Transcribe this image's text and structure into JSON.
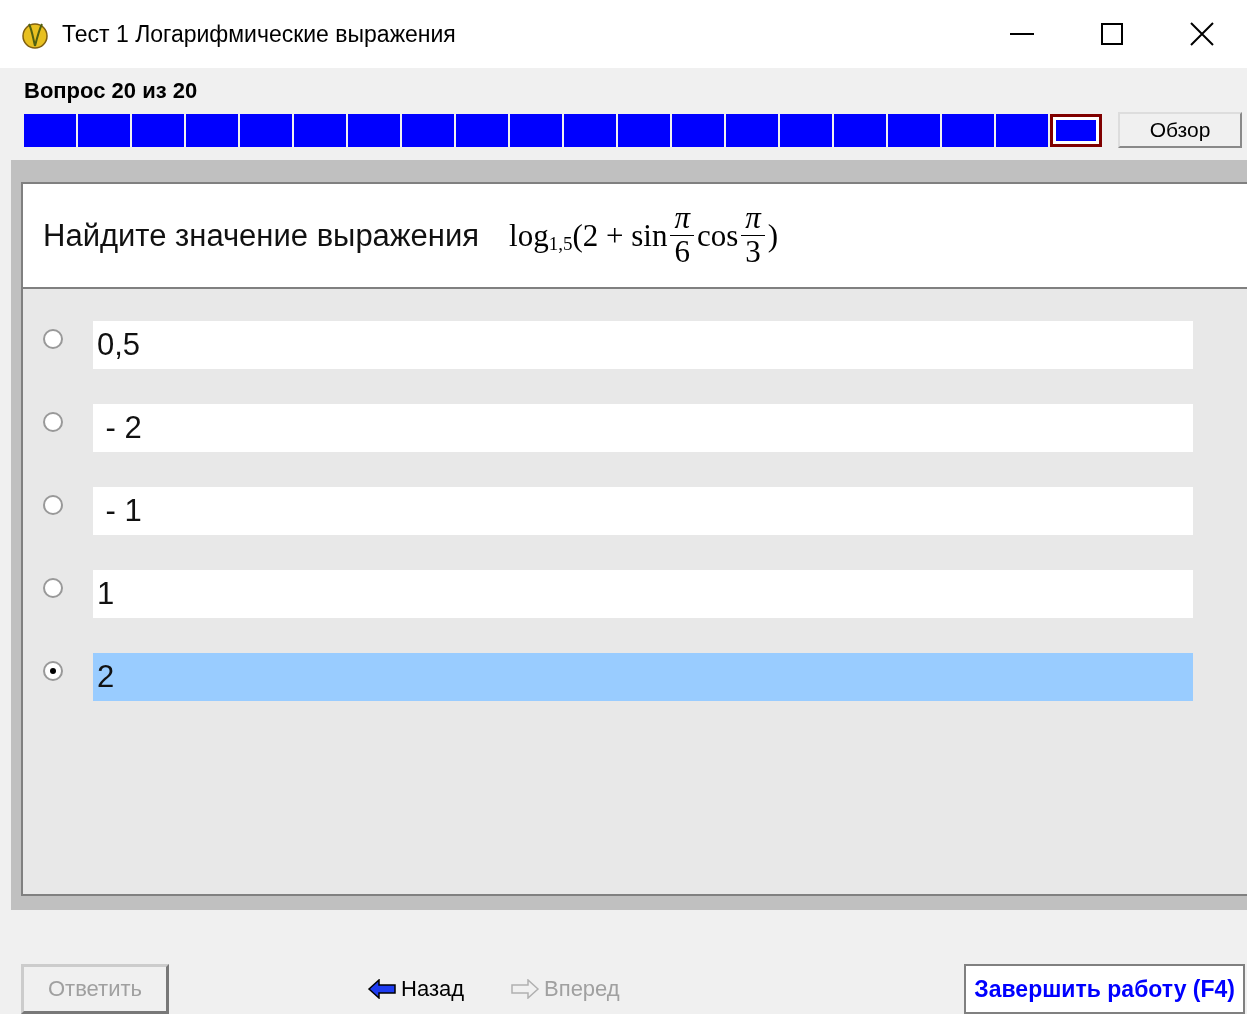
{
  "window": {
    "title": "Тест 1 Логарифмические выражения"
  },
  "question_counter": "Вопрос 20 из 20",
  "progress": [
    {
      "selected": false
    },
    {
      "selected": false
    },
    {
      "selected": false
    },
    {
      "selected": false
    },
    {
      "selected": false
    },
    {
      "selected": false
    },
    {
      "selected": false
    },
    {
      "selected": false
    },
    {
      "selected": false
    },
    {
      "selected": false
    },
    {
      "selected": false
    },
    {
      "selected": false
    },
    {
      "selected": false
    },
    {
      "selected": false
    },
    {
      "selected": false
    },
    {
      "selected": false
    },
    {
      "selected": false
    },
    {
      "selected": false
    },
    {
      "selected": false
    },
    {
      "selected": true
    }
  ],
  "overview_button": "Обзор",
  "question": {
    "prompt": "Найдите  значение выражения",
    "formula": [
      {
        "kind": "text",
        "text": "log"
      },
      {
        "kind": "sub",
        "text": "1,5"
      },
      {
        "kind": "text",
        "text": "(2 + sin"
      },
      {
        "kind": "frac",
        "num": "π",
        "den": "6"
      },
      {
        "kind": "text",
        "text": "cos"
      },
      {
        "kind": "frac",
        "num": "π",
        "den": "3"
      },
      {
        "kind": "text",
        "text": ")"
      }
    ]
  },
  "options": [
    {
      "label": "0,5",
      "selected": false
    },
    {
      "label": " - 2",
      "selected": false
    },
    {
      "label": " - 1",
      "selected": false
    },
    {
      "label": "1",
      "selected": false
    },
    {
      "label": "2",
      "selected": true
    }
  ],
  "buttons": {
    "answer": {
      "label": "Ответить",
      "disabled": true
    },
    "back": {
      "label": "Назад",
      "disabled": false
    },
    "forward": {
      "label": "Вперед",
      "disabled": true
    },
    "finish": {
      "label": "Завершить работу (F4)"
    }
  }
}
